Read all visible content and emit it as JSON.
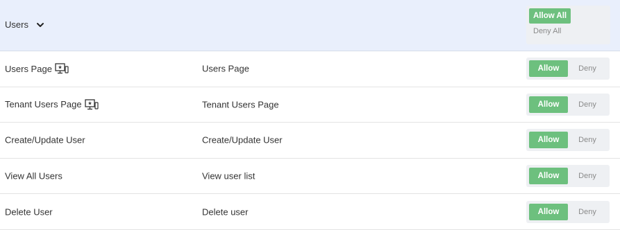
{
  "group": {
    "title": "Users",
    "allow_all_label": "Allow All",
    "deny_all_label": "Deny All"
  },
  "rows": [
    {
      "name": "Users Page",
      "description": "Users Page",
      "page_icon": "page-permission-icon",
      "allow_label": "Allow",
      "deny_label": "Deny",
      "state": "allow"
    },
    {
      "name": "Tenant Users Page",
      "description": "Tenant Users Page",
      "page_icon": "page-permission-icon",
      "allow_label": "Allow",
      "deny_label": "Deny",
      "state": "allow"
    },
    {
      "name": "Create/Update User",
      "description": "Create/Update User",
      "allow_label": "Allow",
      "deny_label": "Deny",
      "state": "allow"
    },
    {
      "name": "View All Users",
      "description": "View user list",
      "allow_label": "Allow",
      "deny_label": "Deny",
      "state": "allow"
    },
    {
      "name": "Delete User",
      "description": "Delete user",
      "allow_label": "Allow",
      "deny_label": "Deny",
      "state": "allow"
    }
  ],
  "colors": {
    "allow_active": "#6dc07e",
    "header_bg": "#e9effc",
    "toggle_bg": "#eef0f3"
  }
}
